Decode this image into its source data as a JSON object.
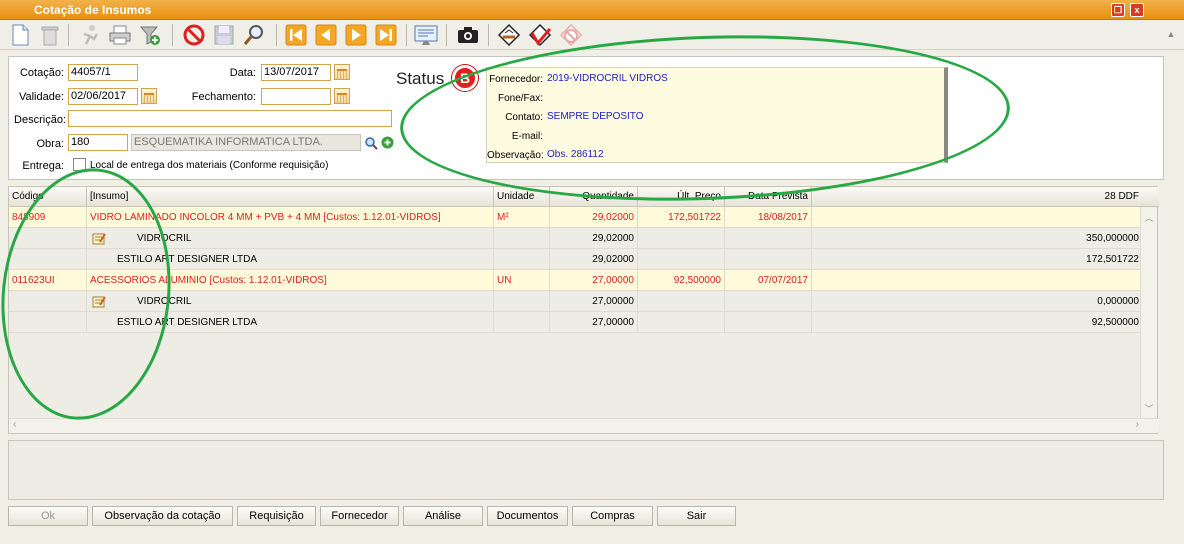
{
  "window": {
    "title": "Cotação de Insumos"
  },
  "form": {
    "cotacao_label": "Cotação:",
    "cotacao_value": "44057/1",
    "data_label": "Data:",
    "data_value": "13/07/2017",
    "validade_label": "Validade:",
    "validade_value": "02/06/2017",
    "fechamento_label": "Fechamento:",
    "fechamento_value": "",
    "descricao_label": "Descrição:",
    "descricao_value": "",
    "obra_label": "Obra:",
    "obra_code": "180",
    "obra_name": "ESQUEMATIKA INFORMATICA LTDA.",
    "entrega_label": "Entrega:",
    "entrega_text": "Local de entrega dos materiais (Conforme requisição)"
  },
  "status": {
    "label": "Status",
    "badge": "B",
    "color": "#e02020"
  },
  "supplier": {
    "fornecedor_label": "Fornecedor:",
    "fornecedor_value": "2019-VIDROCRIL VIDROS",
    "fone_label": "Fone/Fax:",
    "fone_value": "",
    "contato_label": "Contato:",
    "contato_value": "SEMPRE DEPOSITO",
    "email_label": "E-mail:",
    "email_value": "",
    "obs_label": "Observação:",
    "obs_value": "Obs. 286112"
  },
  "grid": {
    "headers": [
      "Código",
      "[Insumo]",
      "Unidade",
      "Quantidade",
      "Últ. Preço",
      "Data Prevista",
      "28 DDF"
    ],
    "rows": [
      {
        "type": "main",
        "codigo": "848909",
        "insumo": "VIDRO LAMINADO INCOLOR 4 MM + PVB + 4 MM [Custos: 1.12.01-VIDROS]",
        "unidade": "M²",
        "quantidade": "29,02000",
        "preco": "172,501722",
        "data": "18/08/2017",
        "ddf": ""
      },
      {
        "type": "sub",
        "edit": true,
        "insumo": "VIDROCRIL",
        "quantidade": "29,02000",
        "ddf": "350,000000"
      },
      {
        "type": "sub",
        "edit": false,
        "insumo": "ESTILO ART DESIGNER LTDA",
        "quantidade": "29,02000",
        "ddf": "172,501722"
      },
      {
        "type": "main",
        "codigo": "011623UI",
        "insumo": "ACESSORIOS ALUMINIO [Custos: 1.12.01-VIDROS]",
        "unidade": "UN",
        "quantidade": "27,00000",
        "preco": "92,500000",
        "data": "07/07/2017",
        "ddf": ""
      },
      {
        "type": "sub",
        "edit": true,
        "insumo": "VIDROCRIL",
        "quantidade": "27,00000",
        "ddf": "0,000000"
      },
      {
        "type": "sub",
        "edit": false,
        "insumo": "ESTILO ART DESIGNER LTDA",
        "quantidade": "27,00000",
        "ddf": "92,500000"
      }
    ]
  },
  "buttons": {
    "ok": "Ok",
    "observacao": "Observação da cotação",
    "requisicao": "Requisição",
    "fornecedor": "Fornecedor",
    "analise": "Análise",
    "documentos": "Documentos",
    "compras": "Compras",
    "sair": "Sair"
  },
  "toolbar_icons": [
    "new-document-icon",
    "trash-icon",
    "run-icon",
    "print-icon",
    "filter-icon",
    "stop-icon",
    "save-icon",
    "search-icon",
    "first-record-icon",
    "previous-record-icon",
    "next-record-icon",
    "last-record-icon",
    "report-icon",
    "camera-icon",
    "approve-icon",
    "reject-icon",
    "cancel-approval-icon"
  ],
  "colors": {
    "titlebar": "#e8900f",
    "highlight_row": "#fffbda",
    "error_text": "#e02020",
    "link_text": "#2020c0",
    "annotation": "#28a745"
  }
}
